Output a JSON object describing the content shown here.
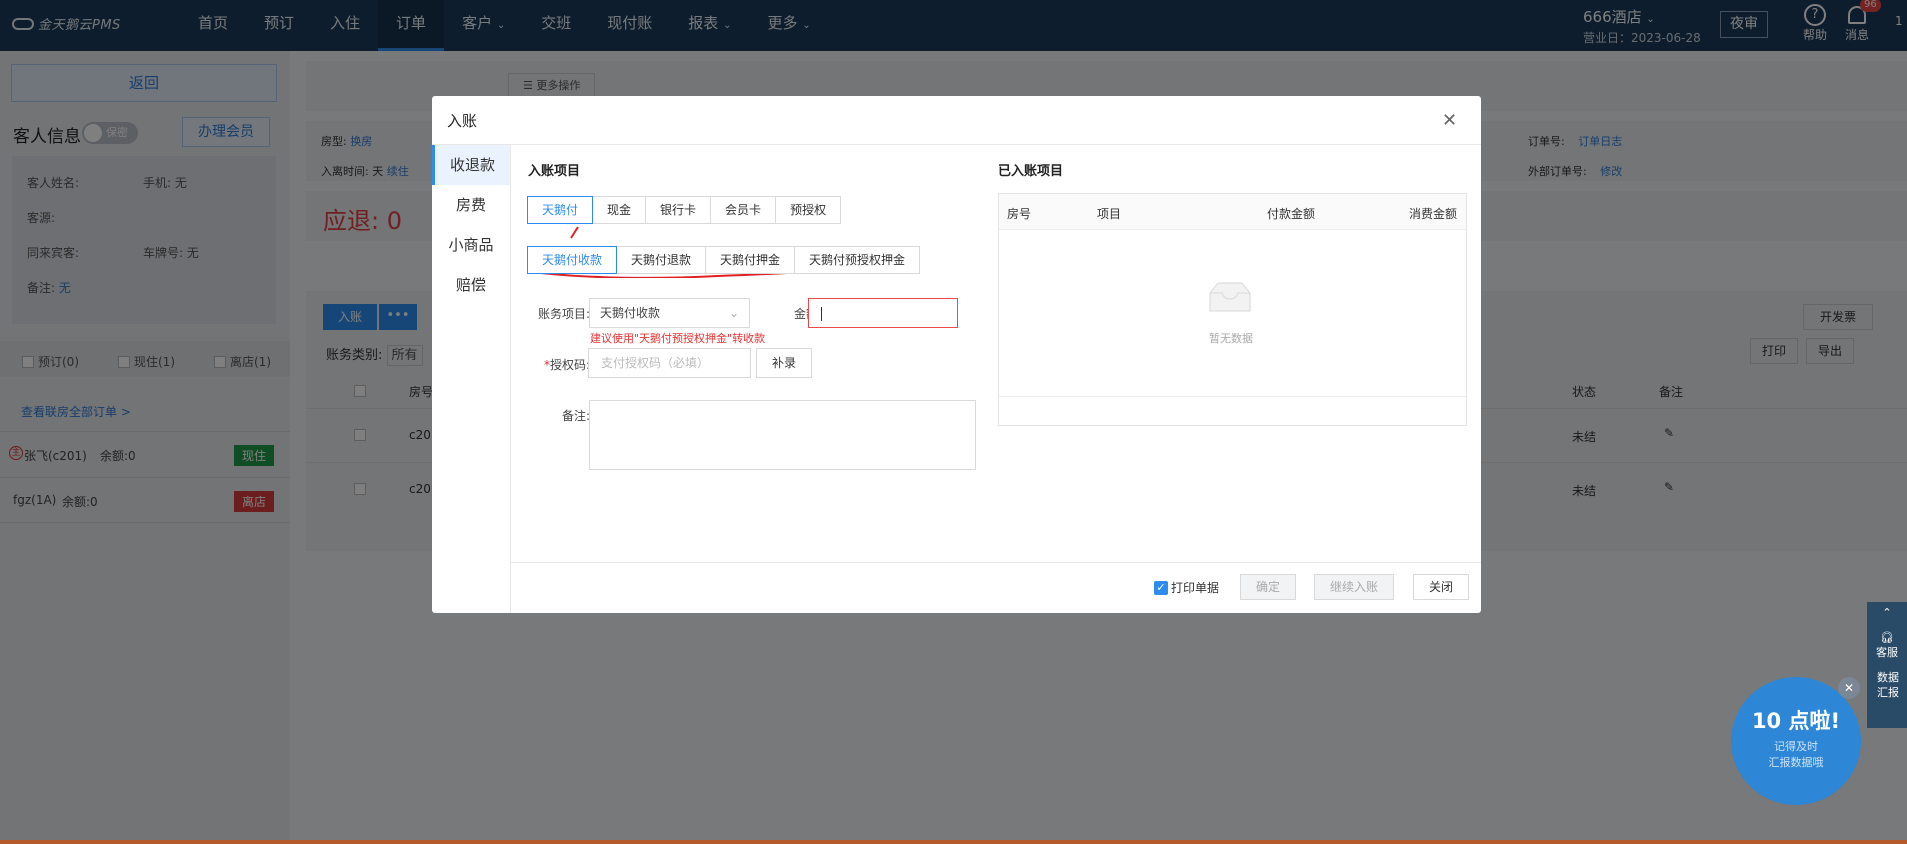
{
  "app": {
    "logo": "金天鹅云PMS",
    "hotel": "666酒店",
    "biz_date": "营业日：2023-06-28",
    "audit": "夜审",
    "help": "帮助",
    "messages": "消息",
    "msg_count": "96",
    "top_one": "1"
  },
  "nav": [
    "首页",
    "预订",
    "入住",
    "订单",
    "客户",
    "交班",
    "现付账",
    "报表",
    "更多"
  ],
  "left": {
    "return": "返回",
    "guest_info": "客人信息",
    "toggle": "保密",
    "member_btn": "办理会员",
    "fields": {
      "name": "客人姓名:",
      "phone": "手机: 无",
      "source": "客源:",
      "companion": "同来宾客:",
      "plate": "车牌号: 无",
      "remark": "备注:",
      "remark_val": "无"
    },
    "filters": [
      "预订(0)",
      "现住(1)",
      "离店(1)"
    ],
    "view_all": "查看联房全部订单 >",
    "rooms": [
      {
        "name": "张飞(c201)",
        "balance": "余额:0",
        "status": "现住",
        "color": "#1e9b48"
      },
      {
        "name": "fgz(1A)",
        "balance": "余额:0",
        "status": "离店",
        "color": "#d83b3b"
      }
    ]
  },
  "main": {
    "more_ops": "更多操作",
    "room_type": "房型:",
    "room_change": "换房",
    "stay": "入离时间: 天",
    "extend": "续住",
    "order_no": "订单号:",
    "order_log": "订单日志",
    "ext_order": "外部订单号:",
    "modify": "修改",
    "refund": "应退: 0",
    "post_btn": "入账",
    "invoice": "开发票",
    "account_type": "账务类别:",
    "account_type_val": "所有",
    "print": "打印",
    "export": "导出",
    "col_room": "房号",
    "col_status": "状态",
    "col_remark": "备注",
    "rows": [
      {
        "room": "c20",
        "status": "未结"
      },
      {
        "room": "c20",
        "status": "未结"
      }
    ]
  },
  "dialog": {
    "title": "入账",
    "side": [
      "收退款",
      "房费",
      "小商品",
      "赔偿"
    ],
    "section_post": "入账项目",
    "pay_types": [
      "天鹅付",
      "现金",
      "银行卡",
      "会员卡",
      "预授权"
    ],
    "sub_types": [
      "天鹅付收款",
      "天鹅付退款",
      "天鹅付押金",
      "天鹅付预授权押金"
    ],
    "account_label": "账务项目:",
    "account_value": "天鹅付收款",
    "amount_label": "金额:",
    "amount_value": "",
    "hint": "建议使用\"天鹅付预授权押金\"转收款",
    "auth_label": "授权码:",
    "auth_required": "*",
    "auth_placeholder": "支付授权码（必填）",
    "supplement": "补录",
    "remark_label": "备注:",
    "section_posted": "已入账项目",
    "table_cols": [
      "房号",
      "项目",
      "付款金额",
      "消费金额"
    ],
    "empty": "暂无数据",
    "print_receipt": "打印单据",
    "confirm": "确定",
    "continue": "继续入账",
    "close": "关闭"
  },
  "widgets": {
    "cs": "客服",
    "data": "数据汇报",
    "promo_big": "10 点啦!",
    "promo_line1": "记得及时",
    "promo_line2": "汇报数据哦"
  }
}
